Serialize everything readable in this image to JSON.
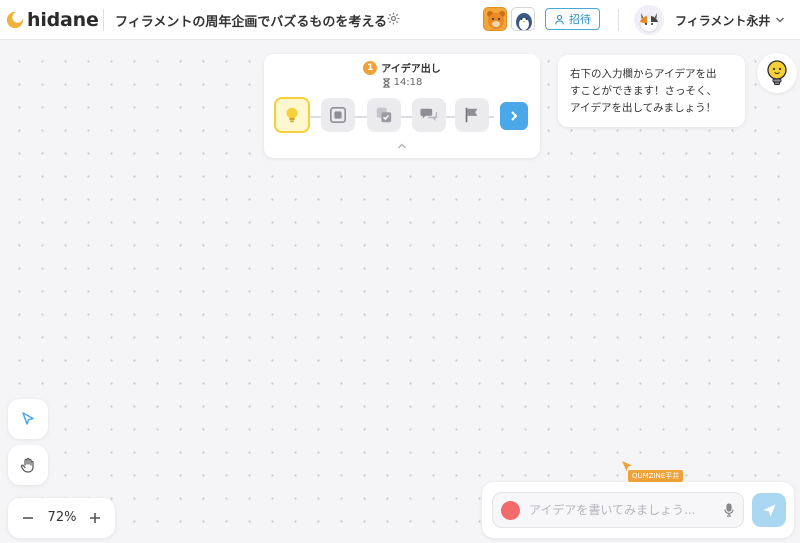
{
  "header": {
    "logo_text": "hidane",
    "project_title": "フィラメントの周年企画でバズるものを考える",
    "invite_label": "招待",
    "user_name": "フィラメント永井"
  },
  "step_panel": {
    "step_number": "1",
    "step_title": "アイデア出し",
    "timer": "14:18",
    "steps": [
      "idea",
      "group",
      "select",
      "discuss",
      "goal"
    ],
    "active_step": 0
  },
  "tip": {
    "lines": [
      "右下の入力欄からアイデアを出",
      "すことができます！さっそく、",
      "アイデアを出してみましょう！"
    ]
  },
  "zoom": {
    "level": "72%"
  },
  "cursor": {
    "label": "QUMZINE平井"
  },
  "input": {
    "placeholder": "アイデアを書いてみましょう..."
  },
  "colors": {
    "accent_blue": "#4aa8e8",
    "brand_orange": "#f0a23a",
    "active_yellow": "#f5d038",
    "record_red": "#f26a6a"
  },
  "icons": {
    "settings": "gear-icon",
    "invite": "person-icon",
    "chevron": "chevron-down-icon",
    "select_tool": "pointer-icon",
    "hand_tool": "hand-icon",
    "send": "paper-plane-icon",
    "mic": "mic-icon"
  }
}
